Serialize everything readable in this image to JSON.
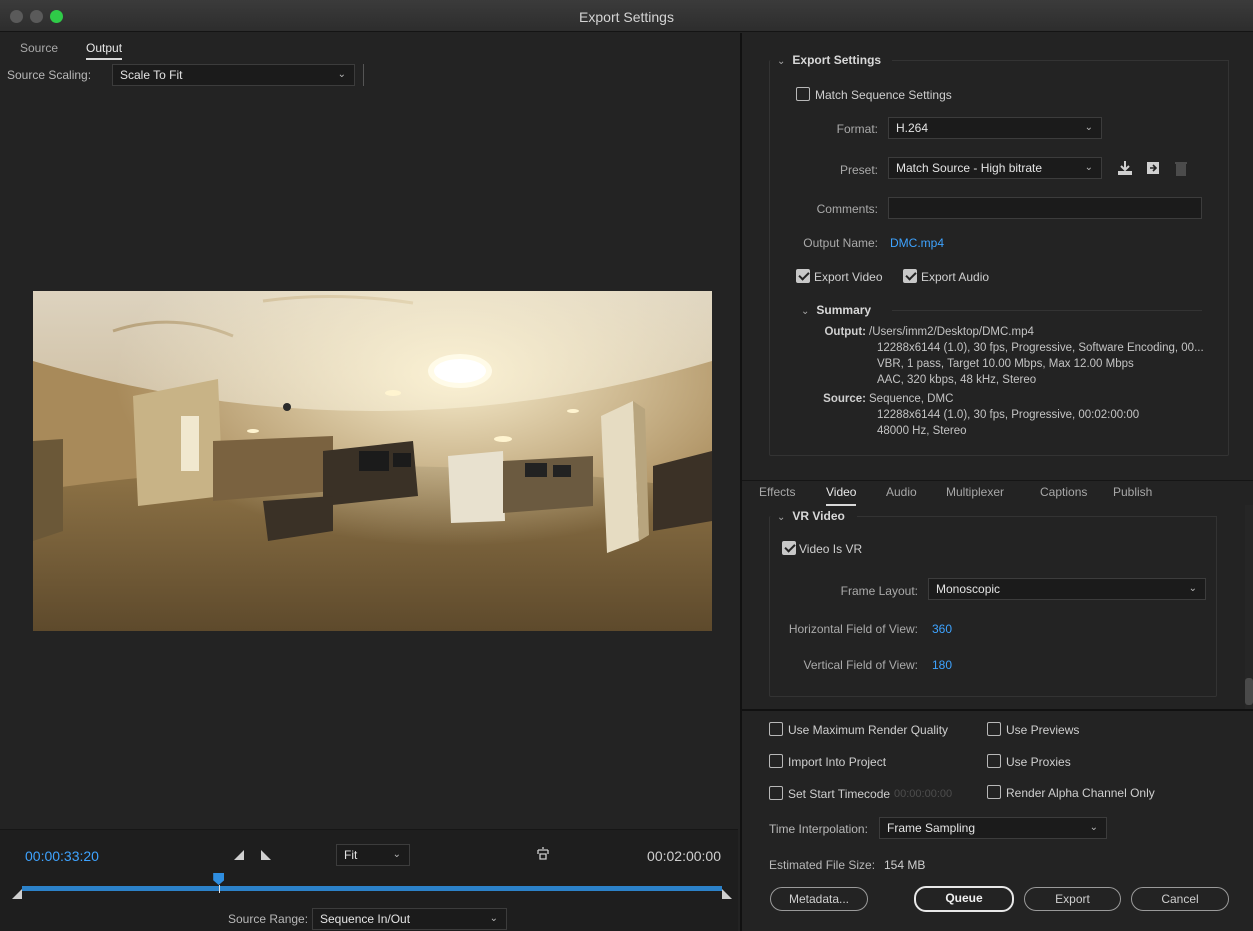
{
  "window": {
    "title": "Export Settings"
  },
  "left": {
    "tabs": [
      {
        "label": "Source"
      },
      {
        "label": "Output",
        "active": true
      }
    ],
    "source_scaling": {
      "label": "Source Scaling:",
      "value": "Scale To Fit"
    },
    "timeline": {
      "current_time": "00:00:33:20",
      "duration": "00:02:00:00",
      "zoom": "Fit",
      "playhead_fraction": 0.281,
      "source_range": {
        "label": "Source Range:",
        "value": "Sequence In/Out"
      }
    }
  },
  "export_settings": {
    "title": "Export Settings",
    "match_sequence": {
      "label": "Match Sequence Settings",
      "checked": false
    },
    "format": {
      "label": "Format:",
      "value": "H.264"
    },
    "preset": {
      "label": "Preset:",
      "value": "Match Source - High bitrate"
    },
    "comments": {
      "label": "Comments:",
      "value": ""
    },
    "output_name": {
      "label": "Output Name:",
      "value": "DMC.mp4"
    },
    "export_video": {
      "label": "Export Video",
      "checked": true
    },
    "export_audio": {
      "label": "Export Audio",
      "checked": true
    },
    "summary": {
      "title": "Summary",
      "output_key": "Output:",
      "output_lines": [
        "/Users/imm2/Desktop/DMC.mp4",
        "12288x6144 (1.0), 30 fps, Progressive, Software Encoding, 00...",
        "VBR, 1 pass, Target 10.00 Mbps, Max 12.00 Mbps",
        "AAC, 320 kbps, 48 kHz, Stereo"
      ],
      "source_key": "Source:",
      "source_lines": [
        "Sequence, DMC",
        "12288x6144 (1.0), 30 fps, Progressive, 00:02:00:00",
        "48000 Hz, Stereo"
      ]
    }
  },
  "settings_tabs": [
    {
      "label": "Effects"
    },
    {
      "label": "Video",
      "active": true
    },
    {
      "label": "Audio"
    },
    {
      "label": "Multiplexer"
    },
    {
      "label": "Captions"
    },
    {
      "label": "Publish"
    }
  ],
  "vr_video": {
    "title": "VR Video",
    "video_is_vr": {
      "label": "Video Is VR",
      "checked": true
    },
    "frame_layout": {
      "label": "Frame Layout:",
      "value": "Monoscopic"
    },
    "hfov": {
      "label": "Horizontal Field of View:",
      "value": "360"
    },
    "vfov": {
      "label": "Vertical Field of View:",
      "value": "180"
    }
  },
  "options": {
    "max_render_quality": {
      "label": "Use Maximum Render Quality",
      "checked": false
    },
    "use_previews": {
      "label": "Use Previews",
      "checked": false
    },
    "import_into_project": {
      "label": "Import Into Project",
      "checked": false
    },
    "use_proxies": {
      "label": "Use Proxies",
      "checked": false
    },
    "set_start_timecode": {
      "label": "Set Start Timecode",
      "value": "00:00:00:00",
      "checked": false
    },
    "render_alpha": {
      "label": "Render Alpha Channel Only",
      "checked": false
    },
    "time_interpolation": {
      "label": "Time Interpolation:",
      "value": "Frame Sampling"
    },
    "file_size": {
      "label": "Estimated File Size:",
      "value": "154 MB"
    }
  },
  "buttons": {
    "metadata": "Metadata...",
    "queue": "Queue",
    "export": "Export",
    "cancel": "Cancel"
  },
  "colors": {
    "accent_blue": "#3ea3ff",
    "timeline_blue": "#2c82c9",
    "close_green": "#2fcb48"
  },
  "icons": [
    "chevron-down-icon",
    "download-preset-icon",
    "import-preset-icon",
    "trash-icon",
    "mark-in-icon",
    "mark-out-icon",
    "crop-icon",
    "playhead-icon"
  ]
}
